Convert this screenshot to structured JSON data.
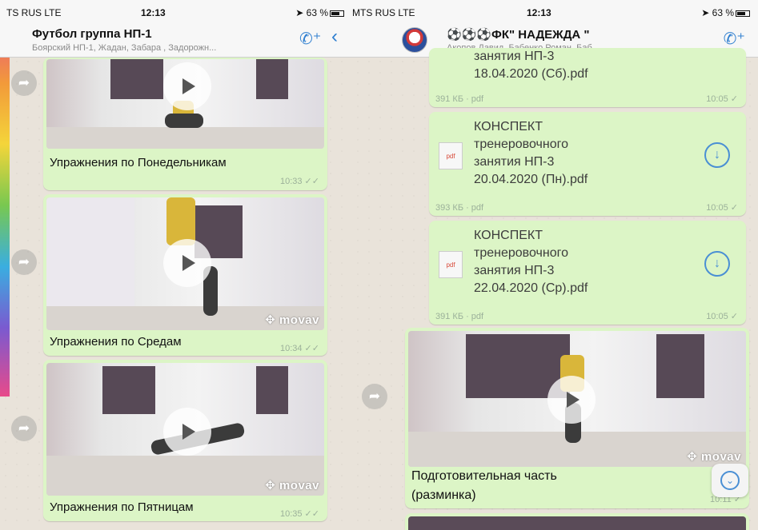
{
  "left": {
    "status": {
      "carrier": "TS RUS  LTE",
      "time": "12:13",
      "battery": "63 %"
    },
    "header": {
      "title": "Футбол группа НП-1",
      "subtitle": "Боярский НП-1, Жадан, Забара , Задорожн...",
      "call_icon": "add-call-icon",
      "back_icon": "chevron-left-icon"
    },
    "messages": [
      {
        "caption": "Упражнения по Понедельникам",
        "time": "10:33"
      },
      {
        "caption": "Упражнения по Средам",
        "time": "10:34",
        "watermark": "movav"
      },
      {
        "caption": "Упражнения по Пятницам",
        "time": "10:35",
        "watermark": "movav"
      }
    ]
  },
  "right": {
    "status": {
      "carrier": "MTS RUS  LTE",
      "time": "12:13",
      "battery": "63 %"
    },
    "header": {
      "title": "⚽⚽⚽ФК\" НАДЕЖДА \"",
      "subtitle": "Акопов Давид, Бабенко Роман, Баб...",
      "call_icon": "add-call-icon"
    },
    "documents": [
      {
        "name_partial": "занятия НП-3\n18.04.2020 (Сб).pdf",
        "size": "391 КБ · pdf",
        "time": "10:05"
      },
      {
        "name": "КОНСПЕКТ\nтренеровочного\nзанятия НП-3\n20.04.2020 (Пн).pdf",
        "size": "393 КБ · pdf",
        "time": "10:05",
        "icon": "pdf"
      },
      {
        "name": "КОНСПЕКТ\nтренеровочного\nзанятия НП-3\n22.04.2020 (Ср).pdf",
        "size": "391 КБ · pdf",
        "time": "10:05",
        "icon": "pdf"
      }
    ],
    "video": {
      "caption": "Подготовительная часть\n(разминка)",
      "time": "10:11",
      "watermark": "movav"
    }
  }
}
